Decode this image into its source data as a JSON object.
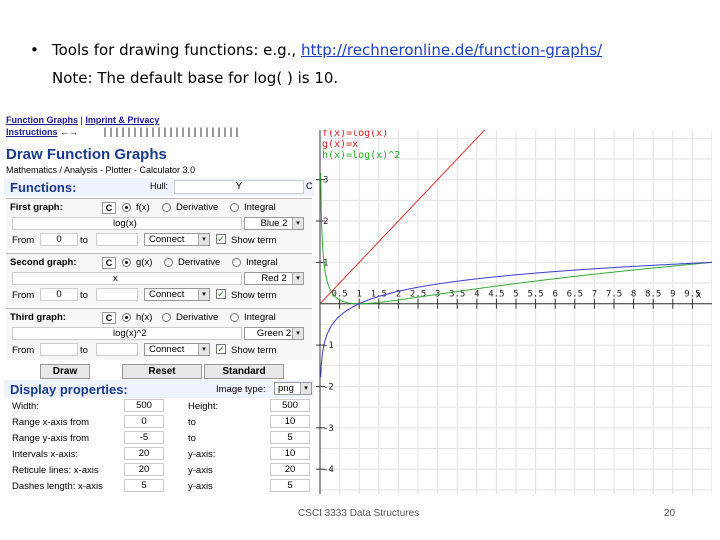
{
  "slide": {
    "bullet": "•",
    "line1_prefix": "Tools for drawing functions: e.g., ",
    "link": "http://rechneronline.de/function-graphs/",
    "line2": "Note: The default base for log( ) is 10.",
    "footer_course": "CSCI 3333 Data Structures",
    "page_number": "20"
  },
  "app": {
    "nav_link1": "Function Graphs",
    "nav_sep": "|",
    "nav_link2": "Imprint & Privacy",
    "instructions": "Instructions",
    "arrow": "←→",
    "ruler": "|||||||||||||||||||||||",
    "title": "Draw Function Graphs",
    "subtitle": "Mathematics / Analysis - Plotter - Calculator 3.0",
    "functions_label": "Functions:",
    "hull_label": "Hull:",
    "hull_value": "Y",
    "hull_c": "C",
    "c_label": "C",
    "derivative": "Derivative",
    "integral": "Integral",
    "from": "From",
    "to": "to",
    "connect": "Connect",
    "show_term": "Show term",
    "dropdown": "▾"
  },
  "graphs": [
    {
      "title": "First graph:",
      "fname": "f(x)",
      "expr": "log(x)",
      "color": "Blue 2",
      "from": "0",
      "to": ""
    },
    {
      "title": "Second graph:",
      "fname": "g(x)",
      "expr": "x",
      "color": "Red 2",
      "from": "0",
      "to": ""
    },
    {
      "title": "Third graph:",
      "fname": "h(x)",
      "expr": "log(x)^2",
      "color": "Green 2",
      "from": "",
      "to": ""
    }
  ],
  "buttons": {
    "draw": "Draw",
    "reset": "Reset",
    "standard": "Standard"
  },
  "display": {
    "label": "Display properties:",
    "image_type_label": "Image type:",
    "image_type": "png",
    "rows": [
      {
        "l1": "Width:",
        "v1": "500",
        "l2": "Height:",
        "v2": "500"
      },
      {
        "l1": "Range x-axis from",
        "v1": "0",
        "l2": "to",
        "v2": "10"
      },
      {
        "l1": "Range y-axis from",
        "v1": "-5",
        "l2": "to",
        "v2": "5"
      },
      {
        "l1": "Intervals x-axis:",
        "v1": "20",
        "l2": "y-axis:",
        "v2": "10"
      },
      {
        "l1": "Reticule lines: x-axis",
        "v1": "20",
        "l2": "y-axis",
        "v2": "20"
      },
      {
        "l1": "Dashes length: x-axis",
        "v1": "5",
        "l2": "y-axis",
        "v2": "5"
      }
    ]
  },
  "chart_data": {
    "type": "line",
    "legend": [
      "f(x)=log(x)",
      "g(x)=x",
      "h(x)=log(x)^2"
    ],
    "legend_colors": [
      "#cc2222",
      "#cc2222",
      "#22aa22"
    ],
    "series_colors": {
      "f": "#3a3acc",
      "g": "#dd3333",
      "h": "#33aa33"
    },
    "x_ticks": [
      "0.5",
      "1",
      "1.5",
      "2",
      "2.5",
      "3",
      "3.5",
      "4",
      "4.5",
      "5",
      "5.5",
      "6",
      "6.5",
      "7",
      "7.5",
      "8",
      "8.5",
      "9",
      "9.5"
    ],
    "y_ticks": [
      "3",
      "2",
      "1",
      "-1",
      "-2",
      "-3",
      "-4"
    ],
    "x_axis_label": "x",
    "x_range": [
      0,
      10
    ],
    "y_range": [
      -4.6,
      4.2
    ],
    "grid": true
  }
}
